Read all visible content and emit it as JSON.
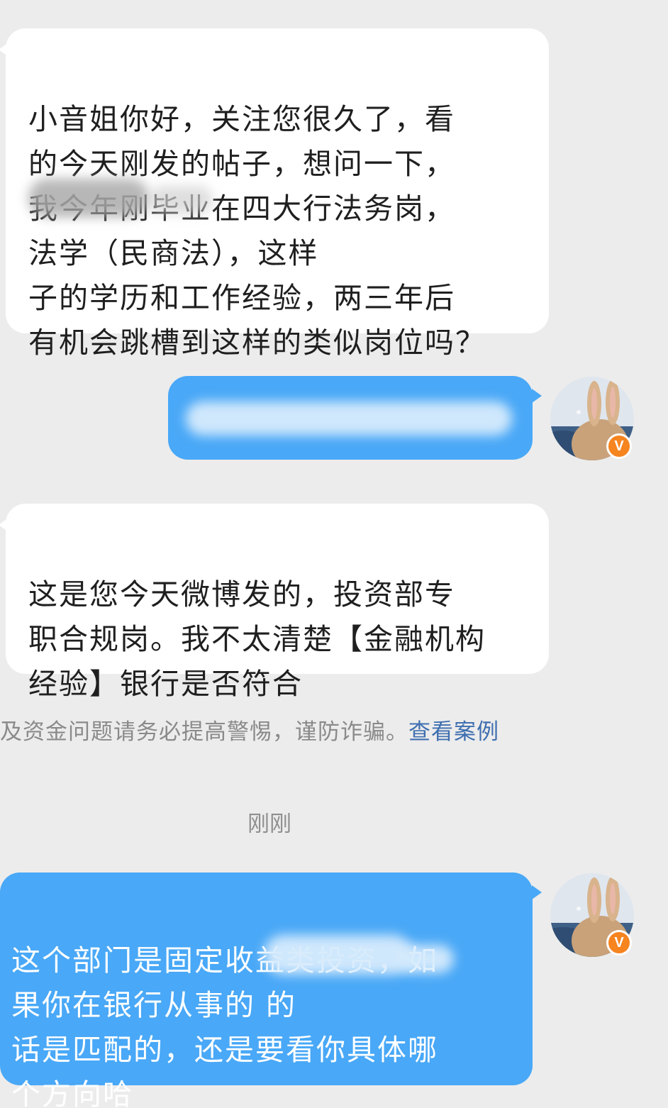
{
  "messages": [
    {
      "side": "incoming",
      "text": "小音姐你好，关注您很久了，看\n的今天刚发的帖子，想问一下，\n我今年刚毕业在四大行法务岗，\n法学（民商法），这样\n子的学历和工作经验，两三年后\n有机会跳槽到这样的类似岗位吗？"
    },
    {
      "side": "outgoing",
      "text": ""
    },
    {
      "side": "incoming",
      "text": "这是您今天微博发的，投资部专\n职合规岗。我不太清楚【金融机构\n经验】银行是否符合"
    },
    {
      "side": "outgoing",
      "text": "这个部门是固定收益类投资，如\n果你在银行从事的          的\n话是匹配的，还是要看你具体哪\n个方向哈"
    }
  ],
  "notice": {
    "text": "及资金问题请务必提高警惕，谨防诈骗。",
    "link": "查看案例"
  },
  "timestamp": "刚刚",
  "avatar": {
    "icon": "bunny-avatar-icon",
    "badge": "V",
    "badge_color": "#f6841f"
  },
  "colors": {
    "background": "#ececec",
    "incoming_bubble": "#ffffff",
    "outgoing_bubble": "#49a8f7",
    "link": "#3f6fb0"
  }
}
